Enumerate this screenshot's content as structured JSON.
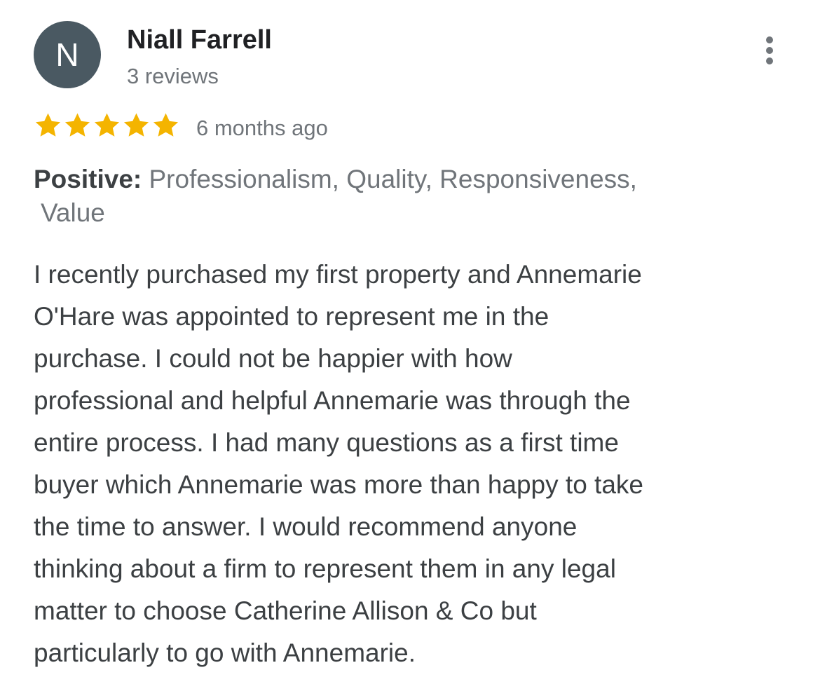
{
  "review": {
    "avatar_letter": "N",
    "reviewer_name": "Niall Farrell",
    "review_count": "3 reviews",
    "rating": 5,
    "max_rating": 5,
    "time_ago": "6 months ago",
    "highlights_label": "Positive:",
    "highlights_line1": "Professionalism, Quality, Responsiveness,",
    "highlights_line2": "Value",
    "text_lines": [
      "I recently purchased my first property and Annemarie",
      "O'Hare was appointed to represent me in the",
      "purchase. I could not be happier with how",
      "professional and helpful Annemarie was through the",
      "entire process. I had many questions as a first time",
      "buyer which Annemarie was more than happy to take",
      "the time to answer. I would recommend anyone",
      "thinking about a firm to represent them in any legal",
      "matter to choose Catherine Allison & Co but",
      "particularly to go with Annemarie."
    ]
  },
  "icons": {
    "star": "star-icon",
    "more": "more-vert-icon"
  },
  "colors": {
    "avatar_bg": "#4a5962",
    "star": "#f4b400",
    "muted_text": "#70757a",
    "body_text": "#3c4043"
  }
}
